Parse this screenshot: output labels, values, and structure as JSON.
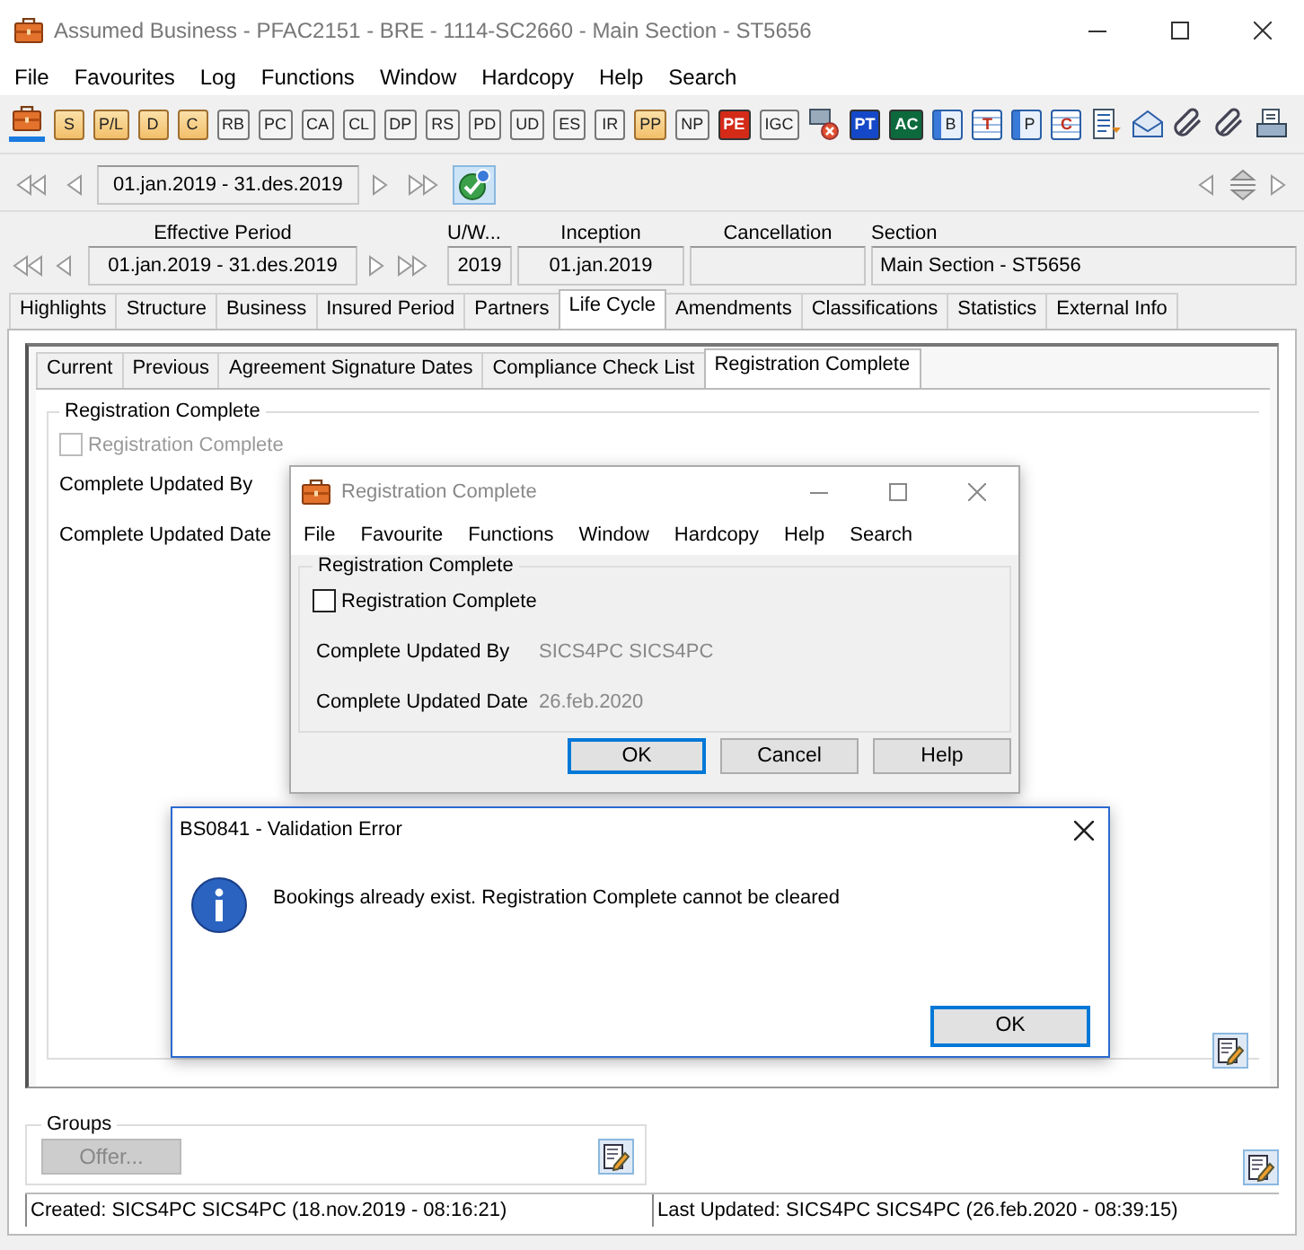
{
  "window": {
    "title": "Assumed Business - PFAC2151 - BRE - 1114-SC2660 - Main Section - ST5656"
  },
  "menu": [
    "File",
    "Favourites",
    "Log",
    "Functions",
    "Window",
    "Hardcopy",
    "Help",
    "Search"
  ],
  "toolbar": {
    "labelled": [
      {
        "label": "S",
        "kind": "folder"
      },
      {
        "label": "P/L",
        "kind": "folder"
      },
      {
        "label": "D",
        "kind": "folder"
      },
      {
        "label": "C",
        "kind": "folder"
      },
      {
        "label": "RB",
        "kind": "plain"
      },
      {
        "label": "PC",
        "kind": "plain"
      },
      {
        "label": "CA",
        "kind": "plain"
      },
      {
        "label": "CL",
        "kind": "plain"
      },
      {
        "label": "DP",
        "kind": "plain"
      },
      {
        "label": "RS",
        "kind": "plain"
      },
      {
        "label": "PD",
        "kind": "plain"
      },
      {
        "label": "UD",
        "kind": "plain"
      },
      {
        "label": "ES",
        "kind": "plain"
      },
      {
        "label": "IR",
        "kind": "plain"
      },
      {
        "label": "PP",
        "kind": "folder"
      },
      {
        "label": "NP",
        "kind": "plain"
      },
      {
        "label": "PE",
        "kind": "tag",
        "color": "#d42a18"
      },
      {
        "label": "IGC",
        "kind": "plain"
      }
    ],
    "tags": [
      {
        "label": "PT",
        "kind": "tag",
        "color": "#1448c8"
      },
      {
        "label": "AC",
        "kind": "tag",
        "color": "#0c6a3c"
      }
    ],
    "pages": [
      {
        "label": "B",
        "kind": "book"
      },
      {
        "label": "T",
        "kind": "grid"
      },
      {
        "label": "P",
        "kind": "book"
      },
      {
        "label": "C",
        "kind": "grid"
      }
    ]
  },
  "period_nav": {
    "range": "01.jan.2019  -  31.des.2019"
  },
  "header": {
    "columns": [
      "Effective Period",
      "U/W...",
      "Inception",
      "Cancellation",
      "Section"
    ],
    "effective_period": "01.jan.2019 - 31.des.2019",
    "uw_year": "2019",
    "inception": "01.jan.2019",
    "section": "Main Section - ST5656"
  },
  "tabs": [
    {
      "label": "Highlights",
      "selected": false
    },
    {
      "label": "Structure",
      "selected": false
    },
    {
      "label": "Business",
      "selected": false
    },
    {
      "label": "Insured Period",
      "selected": false
    },
    {
      "label": "Partners",
      "selected": false
    },
    {
      "label": "Life Cycle",
      "selected": true
    },
    {
      "label": "Amendments",
      "selected": false
    },
    {
      "label": "Classifications",
      "selected": false
    },
    {
      "label": "Statistics",
      "selected": false
    },
    {
      "label": "External Info",
      "selected": false
    }
  ],
  "subtabs": [
    {
      "label": "Current",
      "selected": false
    },
    {
      "label": "Previous",
      "selected": false
    },
    {
      "label": "Agreement Signature Dates",
      "selected": false
    },
    {
      "label": "Compliance Check List",
      "selected": false
    },
    {
      "label": "Registration Complete",
      "selected": true
    }
  ],
  "registration_group": {
    "title": "Registration Complete",
    "checkbox": {
      "label": "Registration Complete",
      "checked": false,
      "disabled": true
    },
    "fields": [
      {
        "label": "Complete Updated By"
      },
      {
        "label": "Complete Updated Date"
      }
    ]
  },
  "groups": {
    "title": "Groups",
    "button": {
      "label": "Offer...",
      "disabled": true
    }
  },
  "status_bar": {
    "created": "Created: SICS4PC SICS4PC (18.nov.2019 - 08:16:21)",
    "last_updated": "Last Updated: SICS4PC SICS4PC (26.feb.2020 - 08:39:15)"
  },
  "dialog": {
    "title": "Registration Complete",
    "menu": [
      "File",
      "Favourite",
      "Functions",
      "Window",
      "Hardcopy",
      "Help",
      "Search"
    ],
    "group_title": "Registration Complete",
    "checkbox": {
      "label": "Registration Complete",
      "checked": false
    },
    "fields": [
      {
        "label": "Complete Updated By",
        "value": "SICS4PC SICS4PC"
      },
      {
        "label": "Complete Updated Date",
        "value": "26.feb.2020"
      }
    ],
    "buttons": [
      {
        "label": "OK",
        "default": true
      },
      {
        "label": "Cancel",
        "default": false
      },
      {
        "label": "Help",
        "default": false
      }
    ]
  },
  "error_dialog": {
    "title": "BS0841 - Validation Error",
    "message": "Bookings already exist. Registration Complete cannot be cleared",
    "button": "OK"
  }
}
